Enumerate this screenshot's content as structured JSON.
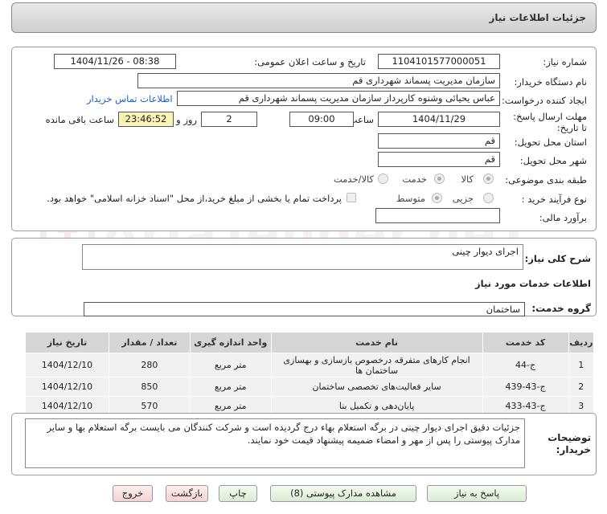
{
  "title": "جزئیات اطلاعات نیاز",
  "fields": {
    "need_number_label": "شماره نیاز:",
    "need_number": "1104101577000051",
    "announce_label": "تاریخ و ساعت اعلان عمومی:",
    "announce_value": "1404/11/26 - 08:38",
    "buyer_org_label": "نام دستگاه خریدار:",
    "buyer_org": "سازمان مدیریت پسماند شهرداری قم",
    "creator_label": "ایجاد کننده درخواست:",
    "creator": "عباس یحیائی وشنوه کارپرداز سازمان مدیریت پسماند شهرداری قم",
    "contact_link": "اطلاعات تماس خریدار",
    "deadline_label": "مهلت ارسال پاسخ: تا تاریخ:",
    "deadline_date": "1404/11/29",
    "time_label": "ساعت",
    "deadline_time": "09:00",
    "days_value": "2",
    "days_label": "روز و",
    "remaining_time": "23:46:52",
    "remaining_label": "ساعت باقی مانده",
    "province_label": "استان محل تحویل:",
    "province": "قم",
    "city_label": "شهر محل تحویل:",
    "city": "قم",
    "category_label": "طبقه بندی موضوعی:",
    "category_options": [
      "کالا",
      "خدمت",
      "کالا/خدمت"
    ],
    "process_label": "نوع فرآیند خرید :",
    "process_options": [
      "جزیی",
      "متوسط"
    ],
    "payment_note": "پرداخت تمام یا بخشی از مبلغ خرید،از محل \"اسناد خزانه اسلامی\" خواهد بود.",
    "estimate_label": "برآورد مالی:",
    "estimate_value": ""
  },
  "summary": {
    "label": "شرح کلی نیاز:",
    "value": "اجرای دیوار چینی"
  },
  "services": {
    "section_title": "اطلاعات خدمات مورد نیاز",
    "group_label": "گروه خدمت:",
    "group_value": "ساختمان"
  },
  "table": {
    "headers": [
      "ردیف",
      "کد خدمت",
      "نام خدمت",
      "واحد اندازه گیری",
      "تعداد / مقدار",
      "تاریخ نیاز"
    ],
    "rows": [
      [
        "1",
        "ج-44",
        "انجام کارهای متفرقه درخصوص بازسازی و بهسازی ساختمان ها",
        "متر مربع",
        "280",
        "1404/12/10"
      ],
      [
        "2",
        "ج-43-439",
        "سایر فعالیت‌های تخصصی ساختمان",
        "متر مربع",
        "850",
        "1404/12/10"
      ],
      [
        "3",
        "ج-43-433",
        "پایان‌دهی و تکمیل بنا",
        "متر مربع",
        "570",
        "1404/12/10"
      ]
    ]
  },
  "buyer_notes": {
    "label": "توضیحات خریدار:",
    "value": "جزئیات دقیق اجرای دیوار چینی در برگه استعلام بهاء درج گردیده است و شرکت کنندگان می بایست برگه استعلام بها و سایر مدارک پیوستی را پس از مهر و امضاء ضمیمه پیشنهاد قیمت خود نمایند."
  },
  "buttons": {
    "reply": "پاسخ به نیاز",
    "attachments": "مشاهده مدارک پیوستی (8)",
    "print": "چاپ",
    "back": "بازگشت",
    "exit": "خروج"
  },
  "watermark": "AriaTender.neT",
  "colors": {
    "link": "#1a5fd0",
    "timer_bg": "#f7f4b5",
    "button_green": "#d8ecd3",
    "button_red": "#f3d3d3"
  }
}
